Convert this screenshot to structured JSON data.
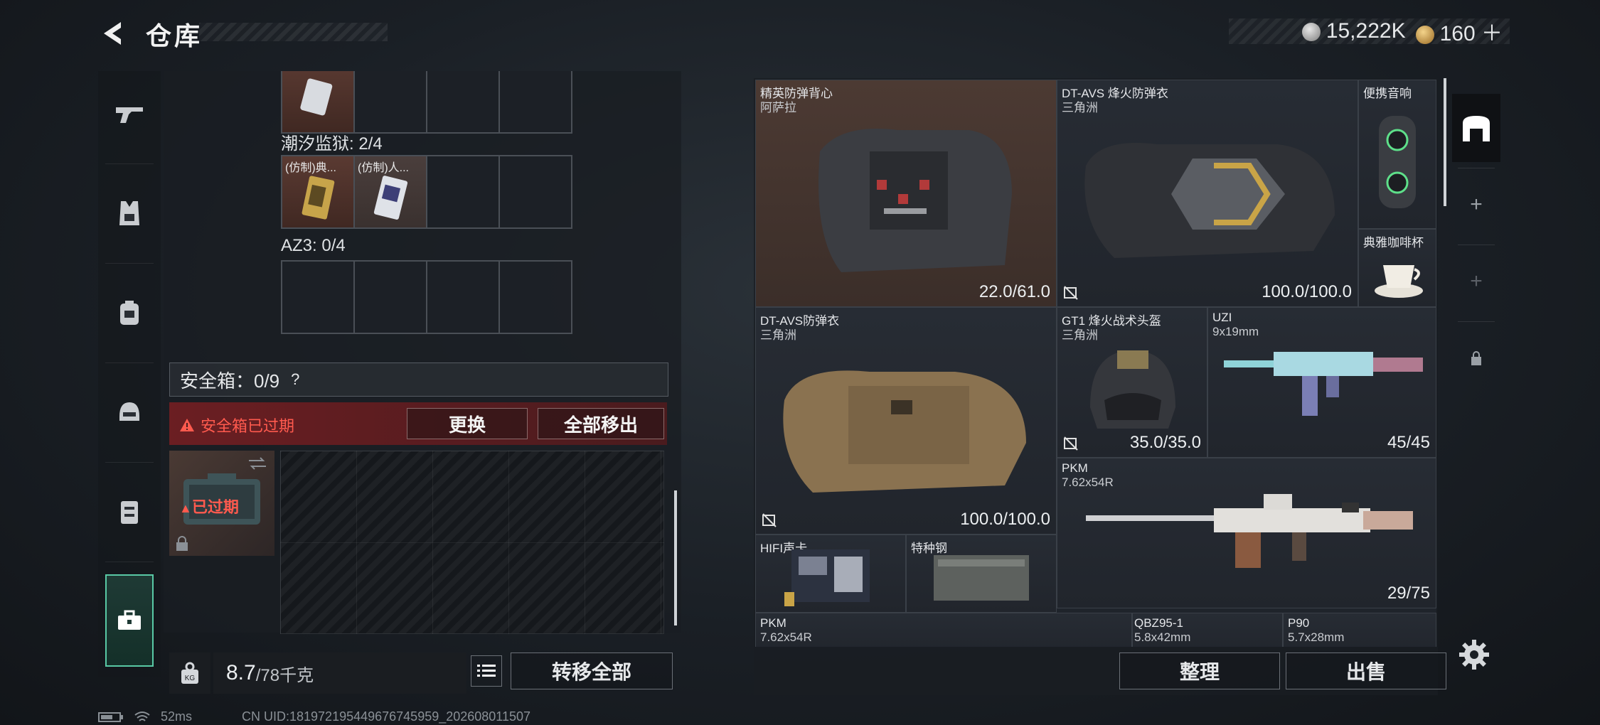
{
  "header": {
    "title": "仓库",
    "silver_amount": "15,222K",
    "gold_amount": "160",
    "gold_plus": "＋"
  },
  "left": {
    "top_cells": [
      {
        "label": ""
      },
      {
        "label": ""
      },
      {
        "label": ""
      },
      {
        "label": ""
      }
    ],
    "section1_label": "潮汐监狱: 2/4",
    "section1_cells": [
      {
        "label": "(仿制)典..."
      },
      {
        "label": "(仿制)人..."
      },
      {
        "label": ""
      },
      {
        "label": ""
      }
    ],
    "section2_label": "AZ3: 0/4",
    "safe_label": "安全箱：0/9",
    "safe_help": "?",
    "expired_text": "安全箱已过期",
    "replace_label": "更换",
    "move_all_label": "全部移出",
    "case_expired_label": "已过期",
    "weight_value": "8.7",
    "weight_unit": "/78千克",
    "transfer_label": "转移全部"
  },
  "inventory": {
    "items": [
      {
        "name": "精英防弹背心",
        "sub": "阿萨拉",
        "durability": "22.0/61.0"
      },
      {
        "name": "DT-AVS 烽火防弹衣",
        "sub": "三角洲",
        "durability": "100.0/100.0"
      },
      {
        "name": "便携音响",
        "sub": "",
        "durability": ""
      },
      {
        "name": "典雅咖啡杯",
        "sub": "",
        "durability": ""
      },
      {
        "name": "DT-AVS防弹衣",
        "sub": "三角洲",
        "durability": "100.0/100.0"
      },
      {
        "name": "GT1 烽火战术头盔",
        "sub": "三角洲",
        "durability": "35.0/35.0"
      },
      {
        "name": "UZI",
        "sub": "9x19mm",
        "durability": "45/45"
      },
      {
        "name": "PKM",
        "sub": "7.62x54R",
        "durability": "29/75"
      },
      {
        "name": "HIFI声卡",
        "sub": "",
        "durability": ""
      },
      {
        "name": "特种钢",
        "sub": "",
        "durability": ""
      },
      {
        "name": "PKM",
        "sub": "7.62x54R",
        "durability": ""
      },
      {
        "name": "QBZ95-1",
        "sub": "5.8x42mm",
        "durability": ""
      },
      {
        "name": "P90",
        "sub": "5.7x28mm",
        "durability": ""
      }
    ],
    "sort_label": "整理",
    "sell_label": "出售"
  },
  "side_tabs": [
    "+",
    "+"
  ],
  "status": {
    "ping": "52ms",
    "uid": "CN UID:18197219544967674595​9_202608011507"
  },
  "colors": {
    "accent": "#59c9a5",
    "danger": "#ff5a4e",
    "highlight_cell": "#4c3a33"
  }
}
